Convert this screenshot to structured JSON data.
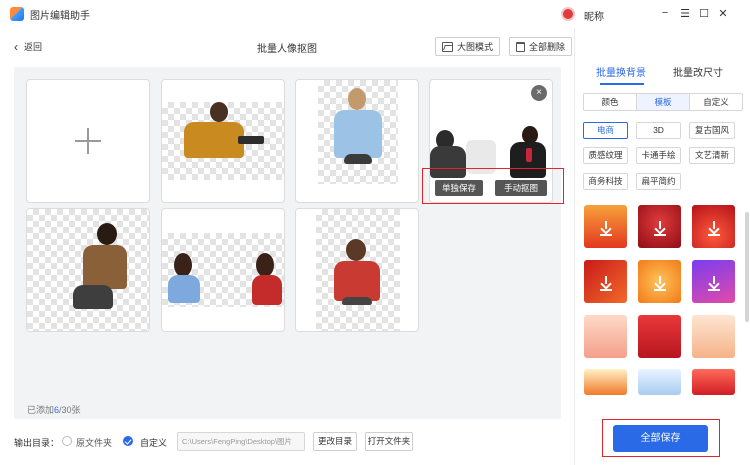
{
  "titlebar": {
    "app_title": "图片编辑助手",
    "nickname": "昵称",
    "min_glyph": "−",
    "menu_glyph": "☰",
    "max_glyph": "☐",
    "close_glyph": "✕"
  },
  "header": {
    "back_label": "返回",
    "back_glyph": "‹",
    "page_title": "批量人像抠图",
    "large_view_label": "大图模式",
    "delete_all_label": "全部删除"
  },
  "card_actions": {
    "close_glyph": "×",
    "save_single_label": "单独保存",
    "manual_cutout_label": "手动抠图"
  },
  "status": {
    "added_prefix": "已添加",
    "added_count": "6",
    "added_suffix": "/30张"
  },
  "footer": {
    "output_label": "输出目录：",
    "option_source_label": "原文件夹",
    "option_custom_label": "自定义",
    "path_value": "C:\\Users\\FengPing\\Desktop\\图片",
    "change_dir_label": "更改目录",
    "open_folder_label": "打开文件夹"
  },
  "right_panel": {
    "tabs": [
      {
        "label": "批量换背景",
        "active": true
      },
      {
        "label": "批量改尺寸",
        "active": false
      }
    ],
    "segments": [
      {
        "label": "颜色",
        "active": false
      },
      {
        "label": "模板",
        "active": true
      },
      {
        "label": "自定义",
        "active": false
      }
    ],
    "style_tags": [
      {
        "label": "电商",
        "active": true
      },
      {
        "label": "3D",
        "active": false
      },
      {
        "label": "复古国风",
        "active": false
      },
      {
        "label": "质感纹理",
        "active": false
      },
      {
        "label": "卡通手绘",
        "active": false
      },
      {
        "label": "文艺清新",
        "active": false
      },
      {
        "label": "商务科技",
        "active": false
      },
      {
        "label": "扁平简约",
        "active": false
      }
    ],
    "save_all_label": "全部保存"
  },
  "colors": {
    "accent": "#2b6ae6",
    "highlight": "#e0252e"
  }
}
